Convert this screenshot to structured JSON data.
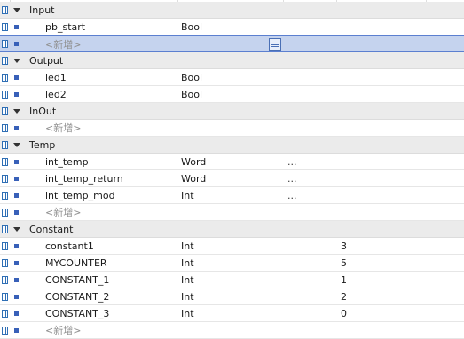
{
  "rows": [
    {
      "kind": "section",
      "name": "Input"
    },
    {
      "kind": "var",
      "name": "pb_start",
      "type": "Bool",
      "default": "",
      "value": ""
    },
    {
      "kind": "placeholder",
      "name": "<新增>",
      "selected": true
    },
    {
      "kind": "section",
      "name": "Output"
    },
    {
      "kind": "var",
      "name": "led1",
      "type": "Bool",
      "default": "",
      "value": ""
    },
    {
      "kind": "var",
      "name": "led2",
      "type": "Bool",
      "default": "",
      "value": ""
    },
    {
      "kind": "section",
      "name": "InOut"
    },
    {
      "kind": "placeholder",
      "name": "<新增>"
    },
    {
      "kind": "section",
      "name": "Temp"
    },
    {
      "kind": "var",
      "name": "int_temp",
      "type": "Word",
      "default": "...",
      "value": ""
    },
    {
      "kind": "var",
      "name": "int_temp_return",
      "type": "Word",
      "default": "...",
      "value": ""
    },
    {
      "kind": "var",
      "name": "int_temp_mod",
      "type": "Int",
      "default": "...",
      "value": ""
    },
    {
      "kind": "placeholder",
      "name": "<新增>"
    },
    {
      "kind": "section",
      "name": "Constant"
    },
    {
      "kind": "var",
      "name": "constant1",
      "type": "Int",
      "default": "",
      "value": "3"
    },
    {
      "kind": "var",
      "name": "MYCOUNTER",
      "type": "Int",
      "default": "",
      "value": "5"
    },
    {
      "kind": "var",
      "name": "CONSTANT_1",
      "type": "Int",
      "default": "",
      "value": "1"
    },
    {
      "kind": "var",
      "name": "CONSTANT_2",
      "type": "Int",
      "default": "",
      "value": "2"
    },
    {
      "kind": "var",
      "name": "CONSTANT_3",
      "type": "Int",
      "default": "",
      "value": "0"
    },
    {
      "kind": "placeholder",
      "name": "<新增>"
    }
  ],
  "icons": {
    "row_icon": "interface-pin-icon",
    "section_toggle": "collapse-triangle-icon",
    "bullet": "variable-bullet-icon",
    "select_button": "data-type-list-icon"
  },
  "colors": {
    "selection": "#c5d3ee",
    "selection_border": "#5b7fd0",
    "section_bg": "#ebebeb",
    "bullet": "#3860b8"
  }
}
